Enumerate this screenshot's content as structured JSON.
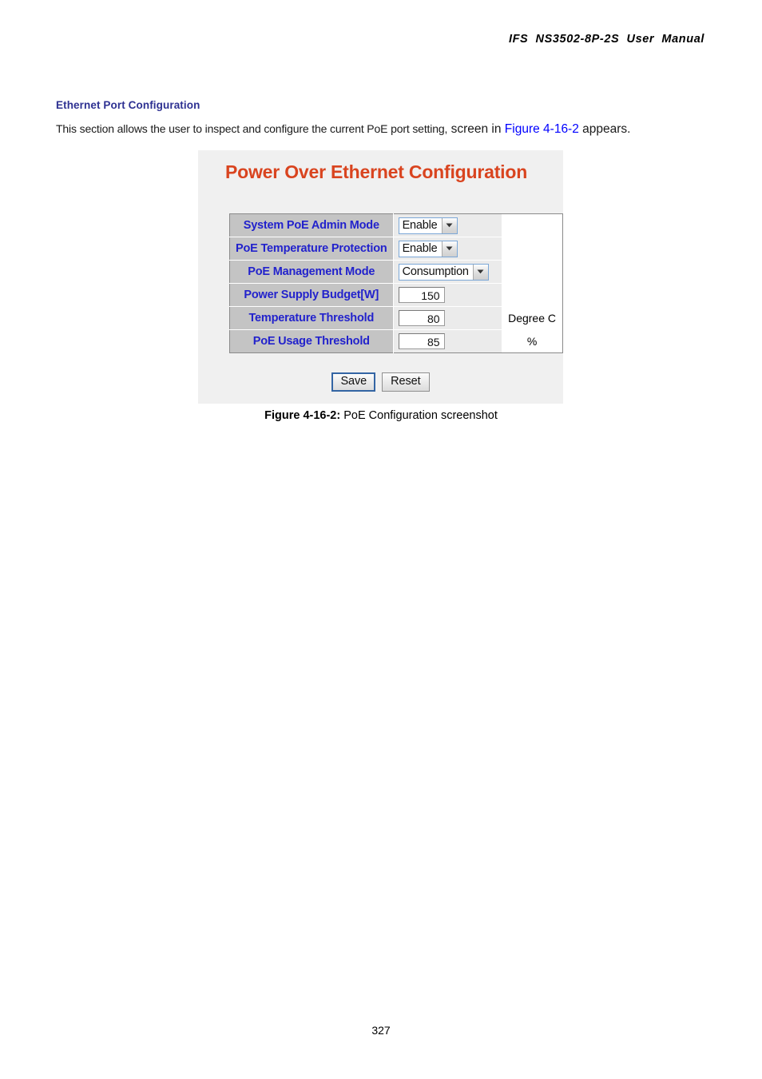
{
  "document": {
    "running_header": "IFS  NS3502-8P-2S  User  Manual",
    "page_number": "327"
  },
  "section": {
    "heading": "Ethernet Port Configuration",
    "intro_part1": "This section allows the user to inspect and configure the current PoE port setting,",
    "intro_part2": "screen in",
    "intro_link": "Figure 4-16-2",
    "intro_part3": "appears."
  },
  "screenshot": {
    "title": "Power Over Ethernet Configuration",
    "rows": [
      {
        "label": "System PoE Admin Mode",
        "control": "select",
        "value": "Enable",
        "unit": ""
      },
      {
        "label": "PoE Temperature Protection",
        "control": "select",
        "value": "Enable",
        "unit": ""
      },
      {
        "label": "PoE Management Mode",
        "control": "select",
        "value": "Consumption",
        "unit": ""
      },
      {
        "label": "Power Supply Budget[W]",
        "control": "text",
        "value": "150",
        "unit": ""
      },
      {
        "label": "Temperature Threshold",
        "control": "text",
        "value": "80",
        "unit": "Degree C"
      },
      {
        "label": "PoE Usage Threshold",
        "control": "text",
        "value": "85",
        "unit": "%"
      }
    ],
    "buttons": {
      "save": "Save",
      "reset": "Reset"
    }
  },
  "figure": {
    "caption_label": "Figure 4-16-2:",
    "caption_text": "PoE Configuration screenshot"
  },
  "colors": {
    "heading_blue": "#2E3192",
    "title_orange": "#D9441F",
    "label_blue": "#2222CC",
    "link_blue": "#0000FF",
    "label_cell_gray": "#C4C4C4",
    "panel_gray": "#F0F0F0"
  }
}
